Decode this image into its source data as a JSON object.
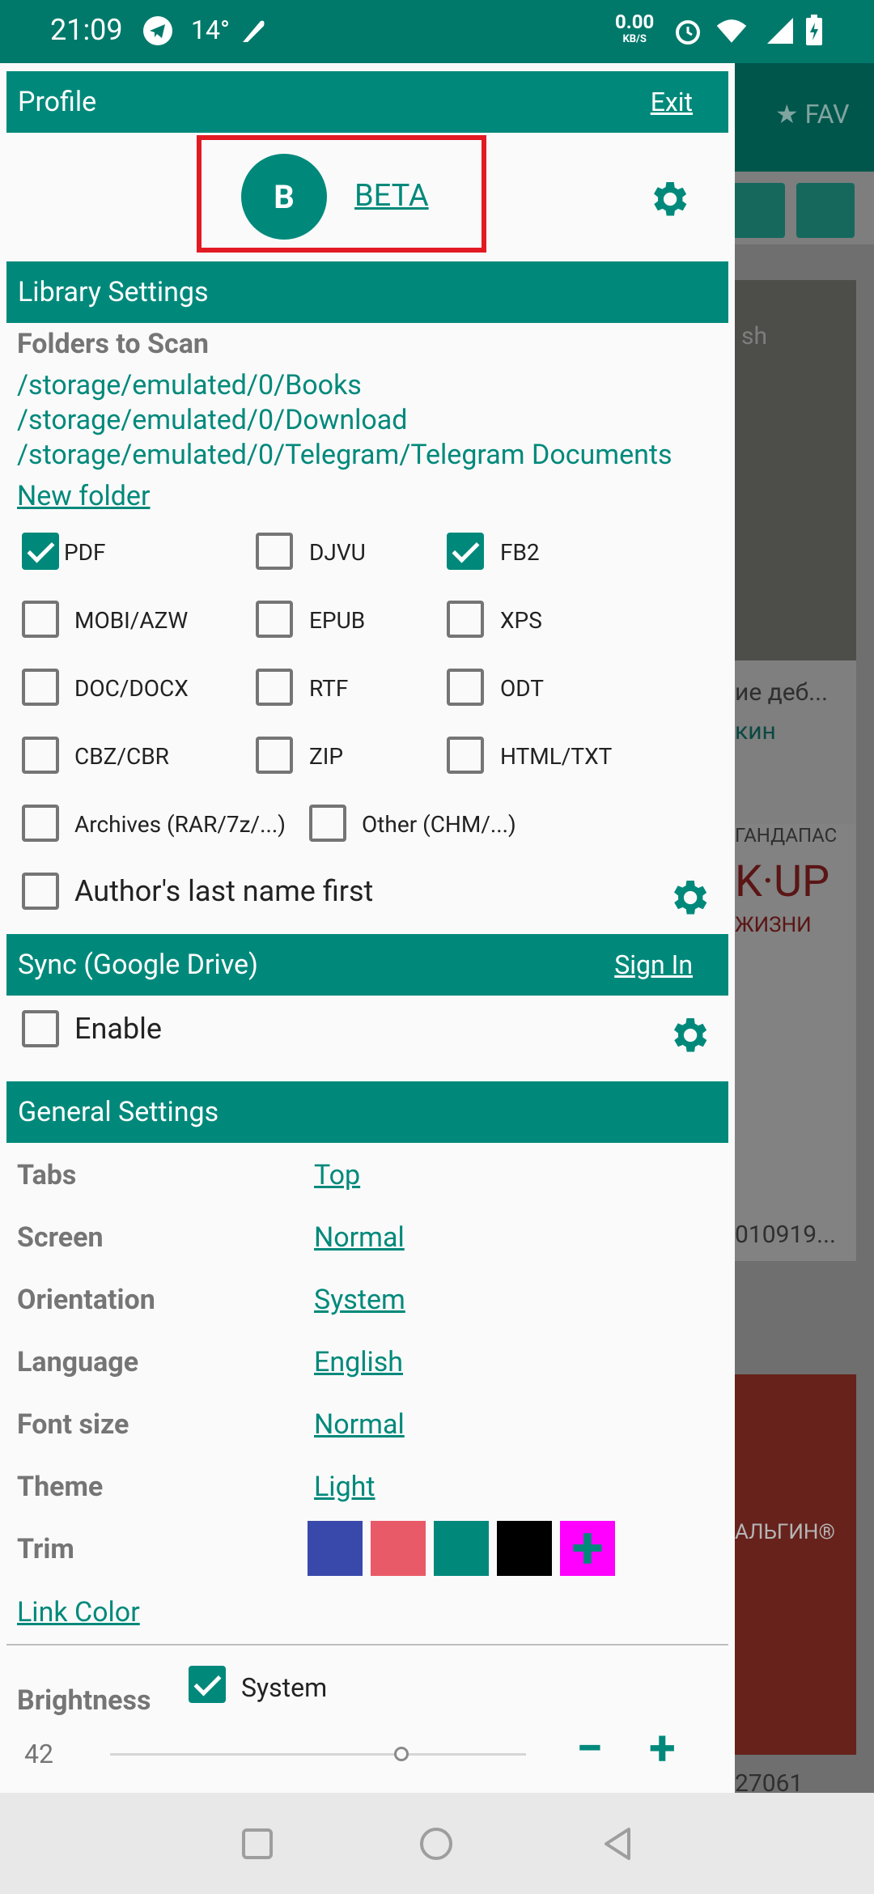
{
  "status_bar": {
    "time": "21:09",
    "temperature": "14°",
    "net_speed": "0.00",
    "net_unit": "KB/S"
  },
  "background_app": {
    "tab_label": "FAV",
    "card_texts": [
      "sh",
      "ие деб...",
      "кин",
      "ГАНДАПАС",
      "K·UP",
      "ЖИЗНИ",
      "010919...",
      "АЛЬГИН®",
      "27061"
    ]
  },
  "profile": {
    "header": "Profile",
    "exit_label": "Exit",
    "avatar_letter": "B",
    "name": "BETA"
  },
  "library": {
    "header": "Library Settings",
    "folders_title": "Folders to Scan",
    "folders": [
      "/storage/emulated/0/Books",
      "/storage/emulated/0/Download",
      "/storage/emulated/0/Telegram/Telegram Documents"
    ],
    "new_folder_label": "New folder",
    "formats": [
      {
        "label": "PDF",
        "checked": true
      },
      {
        "label": "DJVU",
        "checked": false
      },
      {
        "label": "FB2",
        "checked": true
      },
      {
        "label": "MOBI/AZW",
        "checked": false
      },
      {
        "label": "EPUB",
        "checked": false
      },
      {
        "label": "XPS",
        "checked": false
      },
      {
        "label": "DOC/DOCX",
        "checked": false
      },
      {
        "label": "RTF",
        "checked": false
      },
      {
        "label": "ODT",
        "checked": false
      },
      {
        "label": "CBZ/CBR",
        "checked": false
      },
      {
        "label": "ZIP",
        "checked": false
      },
      {
        "label": "HTML/TXT",
        "checked": false
      },
      {
        "label": "Archives (RAR/7z/...)",
        "checked": false
      },
      {
        "label": "Other (CHM/...)",
        "checked": false
      }
    ],
    "author_last_name_first": {
      "label": "Author's last name first",
      "checked": false
    }
  },
  "sync": {
    "header": "Sync (Google Drive)",
    "sign_in_label": "Sign In",
    "enable": {
      "label": "Enable",
      "checked": false
    }
  },
  "general": {
    "header": "General Settings",
    "rows": [
      {
        "label": "Tabs",
        "value": "Top"
      },
      {
        "label": "Screen",
        "value": "Normal"
      },
      {
        "label": "Orientation",
        "value": "System"
      },
      {
        "label": "Language",
        "value": "English"
      },
      {
        "label": "Font size",
        "value": "Normal"
      },
      {
        "label": "Theme",
        "value": "Light"
      }
    ],
    "trim_label": "Trim",
    "trim_colors": [
      "#3949ab",
      "#e85a67",
      "#00897b",
      "#000000",
      "#ff00ff"
    ],
    "add_color_symbol": "+",
    "link_color_label": "Link Color",
    "brightness_label": "Brightness",
    "brightness_system": {
      "label": "System",
      "checked": true
    },
    "brightness_value": "42",
    "brightness_level": 0.7,
    "minus_symbol": "−",
    "plus_symbol": "+"
  },
  "colors": {
    "accent": "#00897b",
    "status_bar": "#00796b",
    "highlight": "#e21b23"
  }
}
